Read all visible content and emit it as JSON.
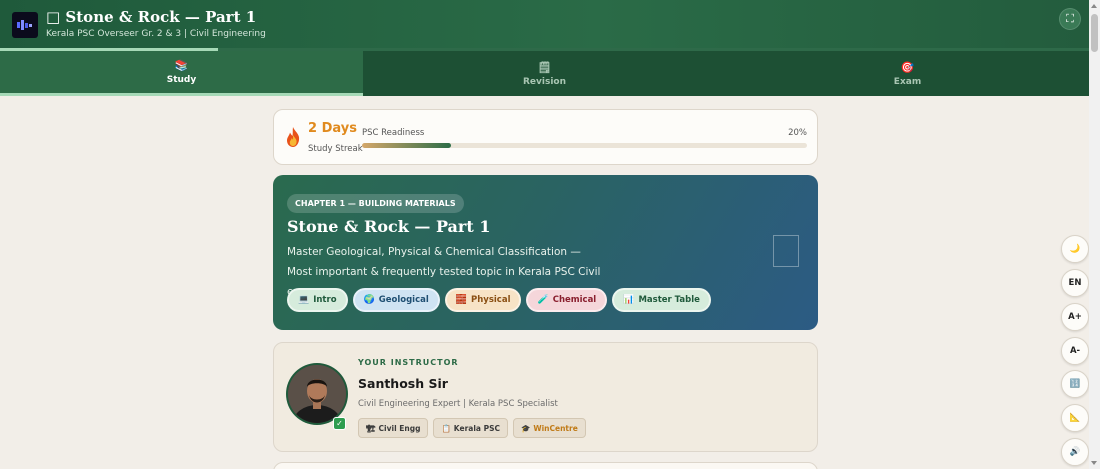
{
  "header": {
    "title_glyph": "□",
    "title": "Stone & Rock — Part 1",
    "subtitle": "Kerala PSC Overseer Gr. 2 & 3 | Civil Engineering",
    "fullscreen_icon": "fullscreen-icon",
    "page_progress": 0.2
  },
  "tabs": [
    {
      "label": "Study",
      "icon": "book-icon",
      "glyph": "📚",
      "active": true
    },
    {
      "label": "Revision",
      "icon": "notepad-icon",
      "glyph": "🗒",
      "active": false
    },
    {
      "label": "Exam",
      "icon": "target-icon",
      "glyph": "🎯",
      "active": false
    }
  ],
  "streak": {
    "value": "2 Days",
    "label": "Study Streak",
    "icon": "flame-icon"
  },
  "readiness": {
    "label": "PSC Readiness",
    "percent_text": "20%",
    "progress": 0.2
  },
  "hero": {
    "chapter": "CHAPTER 1 — BUILDING MATERIALS",
    "title": "Stone & Rock — Part 1",
    "description": "Master Geological, Physical & Chemical Classification — Most important & frequently tested topic in Kerala PSC Civil exams.",
    "chips": [
      {
        "label": "Intro",
        "icon": "monitor-icon",
        "glyph": "💻"
      },
      {
        "label": "Geological",
        "icon": "globe-icon",
        "glyph": "🌍"
      },
      {
        "label": "Physical",
        "icon": "brick-icon",
        "glyph": "🧱"
      },
      {
        "label": "Chemical",
        "icon": "flask-icon",
        "glyph": "🧪"
      },
      {
        "label": "Master Table",
        "icon": "table-icon",
        "glyph": "📊"
      }
    ]
  },
  "instructor": {
    "label": "YOUR INSTRUCTOR",
    "name": "Santhosh Sir",
    "role": "Civil Engineering Expert | Kerala PSC Specialist",
    "verified_glyph": "✓",
    "tags": [
      {
        "label": "Civil Engg",
        "icon": "building-icon",
        "glyph": "🏗"
      },
      {
        "label": "Kerala PSC",
        "icon": "clipboard-icon",
        "glyph": "📋"
      },
      {
        "label": "WinCentre",
        "icon": "graduation-cap-icon",
        "glyph": "🎓"
      }
    ]
  },
  "side_controls": [
    {
      "name": "dark-mode-button",
      "icon": "moon-icon",
      "text": "🌙"
    },
    {
      "name": "language-button",
      "icon": "",
      "text": "EN"
    },
    {
      "name": "font-increase-button",
      "icon": "",
      "text": "A+"
    },
    {
      "name": "font-decrease-button",
      "icon": "",
      "text": "A-"
    },
    {
      "name": "calculator-button",
      "icon": "calculator-icon",
      "text": "🔢"
    },
    {
      "name": "ruler-button",
      "icon": "triangle-ruler-icon",
      "text": "📐"
    },
    {
      "name": "audio-button",
      "icon": "speaker-icon",
      "text": "🔊"
    }
  ],
  "colors": {
    "header_green": "#2a6b47",
    "streak_orange": "#e08a1e",
    "hero_start": "#2a6a4e",
    "hero_end": "#2c5b84",
    "background": "#f2eee8"
  }
}
